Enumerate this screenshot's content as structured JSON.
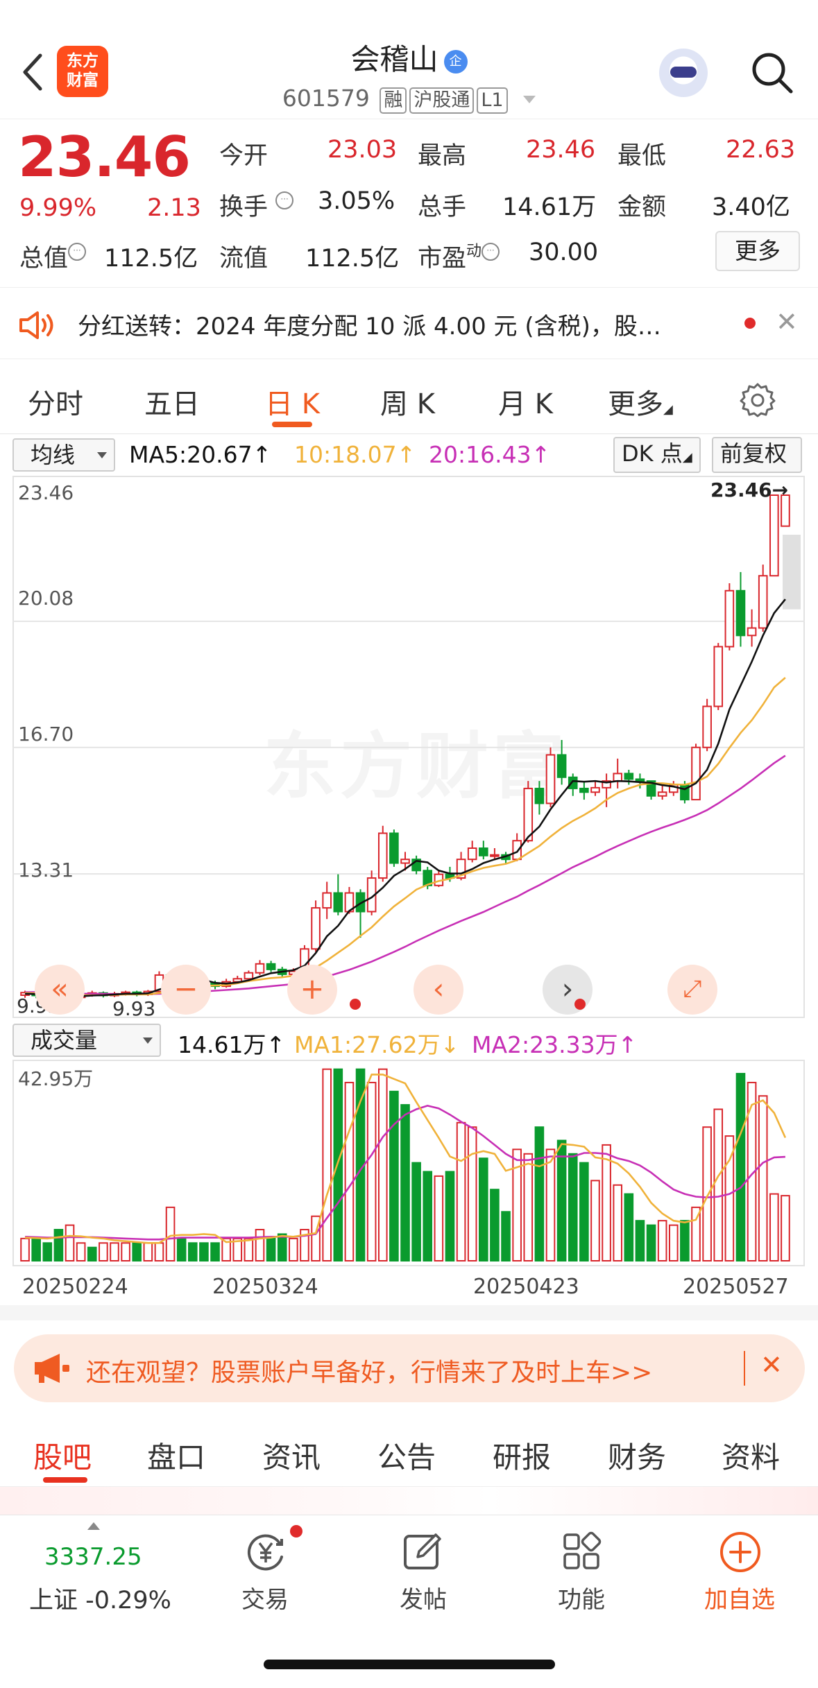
{
  "header": {
    "name": "会稽山",
    "verified_badge": "企",
    "code": "601579",
    "tags": [
      "融",
      "沪股通",
      "L1"
    ],
    "logo_line1": "东方",
    "logo_line2": "财富"
  },
  "quote": {
    "price": "23.46",
    "change_pct": "9.99%",
    "change": "2.13",
    "open_label": "今开",
    "open": "23.03",
    "high_label": "最高",
    "high": "23.46",
    "low_label": "最低",
    "low": "22.63",
    "turnover_label": "换手",
    "turnover": "3.05%",
    "volume_label": "总手",
    "volume": "14.61万",
    "amount_label": "金额",
    "amount": "3.40亿",
    "mktcap_label": "总值",
    "mktcap": "112.5亿",
    "float_label": "流值",
    "float": "112.5亿",
    "pe_label": "市盈",
    "pe_sup": "动",
    "pe": "30.00",
    "more_label": "更多"
  },
  "dividend": {
    "text": "分红送转：2024 年度分配 10 派 4.00 元 (含税)，股…"
  },
  "period_tabs": [
    "分时",
    "五日",
    "日 K",
    "周 K",
    "月 K",
    "更多"
  ],
  "period_active": 2,
  "toolbar": {
    "ma_select": "均线",
    "ma5": "MA5:20.67",
    "ma10": "10:18.07",
    "ma20": "20:16.43",
    "arrow": "↑",
    "dk_label": "DK 点",
    "adjust_label": "前复权"
  },
  "volume_toolbar": {
    "select": "成交量",
    "vol": "14.61万",
    "ma1": "MA1:27.62万",
    "ma1_arrow": "↓",
    "ma2": "MA2:23.33万",
    "ma2_arrow": "↑",
    "arrow": "↑"
  },
  "chart_data": {
    "type": "candlestick",
    "y_ticks": [
      "23.46",
      "20.08",
      "16.70",
      "13.31",
      "9.93"
    ],
    "ylim": [
      9.93,
      23.46
    ],
    "last_price_label": "23.46→",
    "low_marker_label": "9.93",
    "volume_tick": "42.95万",
    "volume_max": 42.95,
    "x_ticks": [
      "20250224",
      "20250324",
      "20250423",
      "20250527"
    ],
    "watermark": "东方财富",
    "candles": [
      [
        10.06,
        10.13,
        9.99,
        10.18
      ],
      [
        10.13,
        10.05,
        9.98,
        10.17
      ],
      [
        10.05,
        9.98,
        9.93,
        10.1
      ],
      [
        9.98,
        10.06,
        9.95,
        10.12
      ],
      [
        10.06,
        10.0,
        9.95,
        10.1
      ],
      [
        10.0,
        10.08,
        9.97,
        10.14
      ],
      [
        10.08,
        10.12,
        10.02,
        10.18
      ],
      [
        10.12,
        10.05,
        10.0,
        10.16
      ],
      [
        10.05,
        10.1,
        10.01,
        10.15
      ],
      [
        10.1,
        10.14,
        10.05,
        10.18
      ],
      [
        10.14,
        10.08,
        10.03,
        10.18
      ],
      [
        10.08,
        10.16,
        10.04,
        10.2
      ],
      [
        10.16,
        10.6,
        10.12,
        10.7
      ],
      [
        10.6,
        10.52,
        10.4,
        10.68
      ],
      [
        10.52,
        10.45,
        10.38,
        10.6
      ],
      [
        10.45,
        10.4,
        10.32,
        10.52
      ],
      [
        10.4,
        10.38,
        10.3,
        10.48
      ],
      [
        10.38,
        10.3,
        10.22,
        10.45
      ],
      [
        10.3,
        10.42,
        10.26,
        10.5
      ],
      [
        10.42,
        10.5,
        10.36,
        10.58
      ],
      [
        10.5,
        10.66,
        10.44,
        10.72
      ],
      [
        10.66,
        10.9,
        10.6,
        11.0
      ],
      [
        10.9,
        10.75,
        10.68,
        10.98
      ],
      [
        10.75,
        10.62,
        10.55,
        10.82
      ],
      [
        10.62,
        10.7,
        10.55,
        10.78
      ],
      [
        10.7,
        11.3,
        10.66,
        11.4
      ],
      [
        11.3,
        12.4,
        11.22,
        12.6
      ],
      [
        12.4,
        12.8,
        12.1,
        13.1
      ],
      [
        12.8,
        12.3,
        12.2,
        13.3
      ],
      [
        12.3,
        12.8,
        12.24,
        12.96
      ],
      [
        12.8,
        12.3,
        11.6,
        12.9
      ],
      [
        12.3,
        13.2,
        12.2,
        13.4
      ],
      [
        13.2,
        14.4,
        13.1,
        14.6
      ],
      [
        14.4,
        13.6,
        13.5,
        14.5
      ],
      [
        13.6,
        13.7,
        13.4,
        13.9
      ],
      [
        13.7,
        13.4,
        13.3,
        13.8
      ],
      [
        13.4,
        13.0,
        12.9,
        13.5
      ],
      [
        13.0,
        13.3,
        12.96,
        13.4
      ],
      [
        13.3,
        13.2,
        13.1,
        13.5
      ],
      [
        13.2,
        13.7,
        13.14,
        13.9
      ],
      [
        13.7,
        14.0,
        13.62,
        14.2
      ],
      [
        14.0,
        13.8,
        13.7,
        14.2
      ],
      [
        13.8,
        13.82,
        13.7,
        14.0
      ],
      [
        13.82,
        13.7,
        13.6,
        13.9
      ],
      [
        13.7,
        14.2,
        13.65,
        14.4
      ],
      [
        14.2,
        15.6,
        14.15,
        15.8
      ],
      [
        15.6,
        15.2,
        14.9,
        15.8
      ],
      [
        15.2,
        16.5,
        15.1,
        16.7
      ],
      [
        16.5,
        15.9,
        15.7,
        16.9
      ],
      [
        15.9,
        15.6,
        15.4,
        16.0
      ],
      [
        15.6,
        15.5,
        15.3,
        15.8
      ],
      [
        15.5,
        15.62,
        15.4,
        15.8
      ],
      [
        15.62,
        15.8,
        15.1,
        16.0
      ],
      [
        15.8,
        16.0,
        15.6,
        16.4
      ],
      [
        16.0,
        15.85,
        15.7,
        16.1
      ],
      [
        15.85,
        15.8,
        15.6,
        16.0
      ],
      [
        15.8,
        15.4,
        15.3,
        15.8
      ],
      [
        15.4,
        15.5,
        15.3,
        15.7
      ],
      [
        15.5,
        15.7,
        15.4,
        15.8
      ],
      [
        15.7,
        15.3,
        15.2,
        15.8
      ],
      [
        15.3,
        16.7,
        15.3,
        16.8
      ],
      [
        16.7,
        17.8,
        16.6,
        18.0
      ],
      [
        17.8,
        19.4,
        17.7,
        19.5
      ],
      [
        19.4,
        20.9,
        19.3,
        21.1
      ],
      [
        20.9,
        19.7,
        19.4,
        21.4
      ],
      [
        19.7,
        19.9,
        19.4,
        20.4
      ],
      [
        19.9,
        21.3,
        19.8,
        21.6
      ],
      [
        21.3,
        23.46,
        22.6,
        23.46
      ],
      [
        22.63,
        23.46,
        22.63,
        23.46
      ]
    ],
    "ma5": [
      10.1,
      10.09,
      10.06,
      10.05,
      10.04,
      10.03,
      10.05,
      10.06,
      10.08,
      10.1,
      10.1,
      10.11,
      10.21,
      10.3,
      10.36,
      10.47,
      10.47,
      10.39,
      10.37,
      10.4,
      10.46,
      10.56,
      10.65,
      10.69,
      10.73,
      10.85,
      11.19,
      11.64,
      11.92,
      12.32,
      12.52,
      12.68,
      12.94,
      13.26,
      13.44,
      13.66,
      13.62,
      13.4,
      13.32,
      13.32,
      13.44,
      13.6,
      13.7,
      13.78,
      13.9,
      14.3,
      14.58,
      15.04,
      15.43,
      15.8,
      15.78,
      15.8,
      15.76,
      15.8,
      15.79,
      15.77,
      15.75,
      15.69,
      15.65,
      15.58,
      15.74,
      16.1,
      16.8,
      17.72,
      18.36,
      19.0,
      19.7,
      20.3,
      20.67
    ],
    "ma10": [
      10.12,
      10.11,
      10.1,
      10.08,
      10.07,
      10.06,
      10.06,
      10.06,
      10.07,
      10.08,
      10.08,
      10.08,
      10.12,
      10.16,
      10.21,
      10.28,
      10.31,
      10.32,
      10.33,
      10.38,
      10.44,
      10.48,
      10.52,
      10.54,
      10.58,
      10.66,
      10.8,
      10.99,
      11.2,
      11.41,
      11.65,
      11.88,
      12.17,
      12.44,
      12.66,
      12.89,
      13.02,
      13.12,
      13.18,
      13.27,
      13.38,
      13.47,
      13.53,
      13.58,
      13.68,
      13.87,
      14.06,
      14.31,
      14.54,
      14.73,
      14.89,
      15.07,
      15.3,
      15.48,
      15.6,
      15.7,
      15.74,
      15.74,
      15.71,
      15.7,
      15.77,
      15.92,
      16.26,
      16.69,
      17.09,
      17.43,
      17.85,
      18.31,
      18.57
    ],
    "ma20": [
      10.14,
      10.14,
      10.13,
      10.12,
      10.11,
      10.1,
      10.1,
      10.1,
      10.09,
      10.09,
      10.09,
      10.09,
      10.1,
      10.11,
      10.12,
      10.14,
      10.16,
      10.18,
      10.2,
      10.22,
      10.24,
      10.27,
      10.3,
      10.33,
      10.36,
      10.41,
      10.48,
      10.56,
      10.65,
      10.74,
      10.85,
      10.96,
      11.09,
      11.22,
      11.36,
      11.51,
      11.65,
      11.79,
      11.92,
      12.05,
      12.17,
      12.29,
      12.43,
      12.57,
      12.7,
      12.86,
      13.01,
      13.17,
      13.33,
      13.49,
      13.63,
      13.77,
      13.92,
      14.06,
      14.19,
      14.32,
      14.44,
      14.55,
      14.65,
      14.76,
      14.88,
      15.02,
      15.2,
      15.4,
      15.6,
      15.82,
      16.05,
      16.28,
      16.48
    ],
    "volumes": [
      5,
      5,
      4,
      7,
      8,
      4,
      3,
      4,
      4,
      4,
      4,
      4,
      4,
      12,
      5,
      4,
      4,
      4,
      5,
      5,
      5,
      7,
      5,
      6,
      5,
      7,
      10,
      43,
      43,
      40,
      43,
      40,
      43,
      38,
      35,
      22,
      20,
      19,
      20,
      31,
      30,
      23,
      16,
      11,
      25,
      24,
      30,
      25,
      27,
      24,
      22,
      18,
      26,
      17,
      15,
      9,
      8,
      9,
      8,
      9,
      12,
      30,
      34,
      28,
      42,
      40,
      37,
      15,
      14.61
    ],
    "vol_up": [
      1,
      0,
      0,
      0,
      1,
      1,
      0,
      1,
      1,
      1,
      0,
      1,
      1,
      1,
      0,
      0,
      0,
      0,
      1,
      1,
      1,
      1,
      0,
      0,
      1,
      1,
      1,
      1,
      0,
      1,
      0,
      1,
      1,
      0,
      0,
      0,
      0,
      1,
      0,
      1,
      1,
      0,
      0,
      0,
      1,
      1,
      0,
      1,
      0,
      0,
      0,
      1,
      1,
      1,
      0,
      0,
      0,
      1,
      1,
      0,
      1,
      1,
      1,
      1,
      0,
      1,
      1,
      1,
      1
    ],
    "vma1": [
      5.2,
      5.1,
      5.0,
      5.3,
      5.6,
      5.5,
      5.2,
      5.0,
      4.6,
      4.4,
      4.2,
      4.0,
      4.0,
      5.6,
      5.8,
      5.8,
      6.0,
      5.8,
      4.2,
      4.4,
      4.6,
      5.0,
      5.2,
      5.6,
      5.4,
      5.8,
      6.2,
      14.8,
      22.2,
      29.2,
      35.8,
      41.8,
      41.8,
      40.8,
      39.8,
      35.6,
      31.6,
      27.6,
      23.4,
      22.4,
      24.0,
      24.6,
      24.0,
      20.2,
      21.0,
      21.8,
      21.2,
      22.2,
      26.2,
      26.0,
      25.6,
      23.2,
      22.8,
      21.8,
      19.6,
      16.6,
      13.0,
      10.6,
      9.0,
      8.6,
      9.2,
      14.4,
      19.0,
      22.6,
      28.6,
      35.0,
      36.0,
      33.2,
      27.62
    ],
    "vma2": [
      5.4,
      5.3,
      5.2,
      5.2,
      5.3,
      5.3,
      5.3,
      5.2,
      5.1,
      5.0,
      4.9,
      4.8,
      4.8,
      5.0,
      5.2,
      5.2,
      5.2,
      5.2,
      5.2,
      5.2,
      5.2,
      5.3,
      5.4,
      5.4,
      5.4,
      5.6,
      6.0,
      9.6,
      13.0,
      16.6,
      20.4,
      23.8,
      27.8,
      30.6,
      32.8,
      34.0,
      34.8,
      34.2,
      32.8,
      31.2,
      29.8,
      28.0,
      26.0,
      24.0,
      22.6,
      22.6,
      23.0,
      23.4,
      23.4,
      23.4,
      24.2,
      24.2,
      24.0,
      23.0,
      22.4,
      21.4,
      19.8,
      17.8,
      16.0,
      15.0,
      14.4,
      14.2,
      14.4,
      15.0,
      16.4,
      19.4,
      22.0,
      23.2,
      23.33
    ]
  },
  "promo": {
    "text": "还在观望？股票账户早备好，行情来了及时上车>>"
  },
  "content_tabs": [
    "股吧",
    "盘口",
    "资讯",
    "公告",
    "研报",
    "财务",
    "资料"
  ],
  "content_active": 0,
  "bottom_nav": {
    "index_value": "3337.25",
    "index_label": "上证 -0.29%",
    "items": [
      "交易",
      "发帖",
      "功能",
      "加自选"
    ]
  },
  "colors": {
    "up": "#d9262c",
    "down": "#0a9b2e",
    "ma5": "#111111",
    "ma10": "#f0b23a",
    "ma20": "#c72fb5",
    "accent": "#f05a1f"
  }
}
